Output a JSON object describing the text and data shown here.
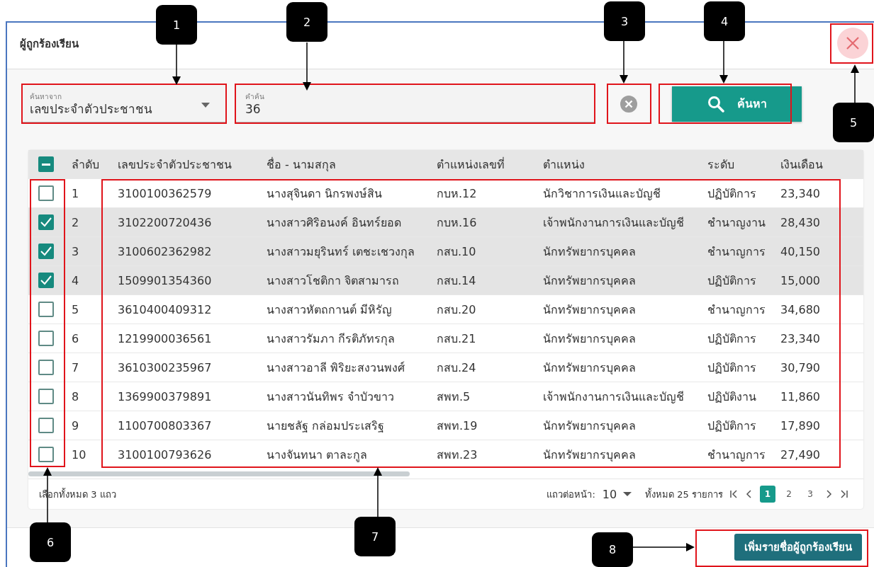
{
  "dialog": {
    "title": "ผู้ถูกร้องเรียน"
  },
  "search": {
    "by_label": "ค้นหาจาก",
    "by_value": "เลขประจำตัวประชาชน",
    "term_label": "คำค้น",
    "term_value": "36",
    "button": "ค้นหา"
  },
  "table": {
    "select_all": {
      "indeterminate": true
    },
    "columns": [
      "ลำดับ",
      "เลขประจำตัวประชาชน",
      "ชื่อ - นามสกุล",
      "ตำแหน่งเลขที่",
      "ตำแหน่ง",
      "ระดับ",
      "เงินเดือน"
    ],
    "rows": [
      {
        "checked": false,
        "cells": [
          "1",
          "3100100362579",
          "นางสุจินดา นิกรพงษ์สิน",
          "กบห.12",
          "นักวิชาการเงินและบัญชี",
          "ปฏิบัติการ",
          "23,340"
        ]
      },
      {
        "checked": true,
        "cells": [
          "2",
          "3102200720436",
          "นางสาวศิริอนงค์ อินทร์ยอด",
          "กบห.16",
          "เจ้าพนักงานการเงินและบัญชี",
          "ชำนาญงาน",
          "28,430"
        ]
      },
      {
        "checked": true,
        "cells": [
          "3",
          "3100602362982",
          "นางสาวมยุรินทร์ เตชะเชวงกุล",
          "กสบ.10",
          "นักทรัพยากรบุคคล",
          "ชำนาญการ",
          "40,150"
        ]
      },
      {
        "checked": true,
        "cells": [
          "4",
          "1509901354360",
          "นางสาวโชติกา จิตสามารถ",
          "กสบ.14",
          "นักทรัพยากรบุคคล",
          "ปฏิบัติการ",
          "15,000"
        ]
      },
      {
        "checked": false,
        "cells": [
          "5",
          "3610400409312",
          "นางสาวหัตถกานต์ มีหิรัญ",
          "กสบ.20",
          "นักทรัพยากรบุคคล",
          "ชำนาญการ",
          "34,680"
        ]
      },
      {
        "checked": false,
        "cells": [
          "6",
          "1219900036561",
          "นางสาวรัมภา กีรติภัทรกุล",
          "กสบ.21",
          "นักทรัพยากรบุคคล",
          "ปฏิบัติการ",
          "23,340"
        ]
      },
      {
        "checked": false,
        "cells": [
          "7",
          "3610300235967",
          "นางสาวอาลี พิริยะสงวนพงศ์",
          "กสบ.24",
          "นักทรัพยากรบุคคล",
          "ปฏิบัติการ",
          "30,790"
        ]
      },
      {
        "checked": false,
        "cells": [
          "8",
          "1369900379891",
          "นางสาวนันทิพร จำบัวขาว",
          "สพท.5",
          "เจ้าพนักงานการเงินและบัญชี",
          "ปฏิบัติงาน",
          "11,860"
        ]
      },
      {
        "checked": false,
        "cells": [
          "9",
          "1100700803367",
          "นายชลัฐ กล่อมประเสริฐ",
          "สพท.19",
          "นักทรัพยากรบุคคล",
          "ปฏิบัติการ",
          "17,890"
        ]
      },
      {
        "checked": false,
        "cells": [
          "10",
          "3100100793626",
          "นางจันทนา ตาละกูล",
          "สพท.23",
          "นักทรัพยากรบุคคล",
          "ชำนาญการ",
          "27,490"
        ]
      }
    ]
  },
  "table_footer": {
    "selection_text": "เลือกทั้งหมด 3 แถว",
    "rows_per_page_label": "แถวต่อหน้า:",
    "rows_per_page": "10",
    "total": "ทั้งหมด 25 รายการ",
    "pages": [
      {
        "label": "1",
        "selected": true
      },
      {
        "label": "2",
        "selected": false
      },
      {
        "label": "3",
        "selected": false
      }
    ]
  },
  "add_button": "เพิ่มรายชื่อผู้ถูกร้องเรียน",
  "callouts": [
    {
      "label": "1"
    },
    {
      "label": "2"
    },
    {
      "label": "3"
    },
    {
      "label": "4"
    },
    {
      "label": "5"
    },
    {
      "label": "6"
    },
    {
      "label": "7"
    },
    {
      "label": "8"
    }
  ]
}
